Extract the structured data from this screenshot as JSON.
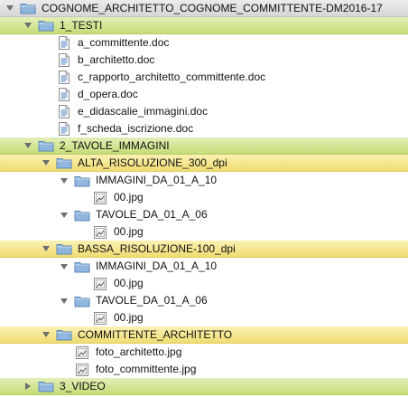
{
  "colors": {
    "folder_fill": "#8fb7df",
    "folder_stroke": "#5d86b3",
    "row_green": "#c6dc78",
    "row_yellow": "#efdc72",
    "row_gray": "#d6d6d6"
  },
  "tree": [
    {
      "label": "COGNOME_ARCHITETTO_COGNOME_COMMITTENTE-DM2016-17",
      "kind": "folder",
      "expanded": true,
      "depth": 0,
      "highlight": "gray"
    },
    {
      "label": "1_TESTI",
      "kind": "folder",
      "expanded": true,
      "depth": 1,
      "highlight": "green"
    },
    {
      "label": "a_committente.doc",
      "kind": "doc",
      "depth": 2
    },
    {
      "label": "b_architetto.doc",
      "kind": "doc",
      "depth": 2
    },
    {
      "label": "c_rapporto_architetto_committente.doc",
      "kind": "doc",
      "depth": 2
    },
    {
      "label": "d_opera.doc",
      "kind": "doc",
      "depth": 2
    },
    {
      "label": "e_didascalie_immagini.doc",
      "kind": "doc",
      "depth": 2
    },
    {
      "label": "f_scheda_iscrizione.doc",
      "kind": "doc",
      "depth": 2
    },
    {
      "label": "2_TAVOLE_IMMAGINI",
      "kind": "folder",
      "expanded": true,
      "depth": 1,
      "highlight": "green"
    },
    {
      "label": "ALTA_RISOLUZIONE_300_dpi",
      "kind": "folder",
      "expanded": true,
      "depth": 2,
      "highlight": "yellow"
    },
    {
      "label": "IMMAGINI_DA_01_A_10",
      "kind": "folder",
      "expanded": true,
      "depth": 3
    },
    {
      "label": "00.jpg",
      "kind": "image",
      "depth": 4
    },
    {
      "label": "TAVOLE_DA_01_A_06",
      "kind": "folder",
      "expanded": true,
      "depth": 3
    },
    {
      "label": "00.jpg",
      "kind": "image",
      "depth": 4
    },
    {
      "label": "BASSA_RISOLUZIONE-100_dpi",
      "kind": "folder",
      "expanded": true,
      "depth": 2,
      "highlight": "yellow"
    },
    {
      "label": "IMMAGINI_DA_01_A_10",
      "kind": "folder",
      "expanded": true,
      "depth": 3
    },
    {
      "label": "00.jpg",
      "kind": "image",
      "depth": 4
    },
    {
      "label": "TAVOLE_DA_01_A_06",
      "kind": "folder",
      "expanded": true,
      "depth": 3
    },
    {
      "label": "00.jpg",
      "kind": "image",
      "depth": 4
    },
    {
      "label": "COMMITTENTE_ARCHITETTO",
      "kind": "folder",
      "expanded": true,
      "depth": 2,
      "highlight": "yellow"
    },
    {
      "label": "foto_architetto.jpg",
      "kind": "image",
      "depth": 3
    },
    {
      "label": "foto_committente.jpg",
      "kind": "image",
      "depth": 3
    },
    {
      "label": "3_VIDEO",
      "kind": "folder",
      "expanded": false,
      "depth": 1,
      "highlight": "green"
    }
  ]
}
